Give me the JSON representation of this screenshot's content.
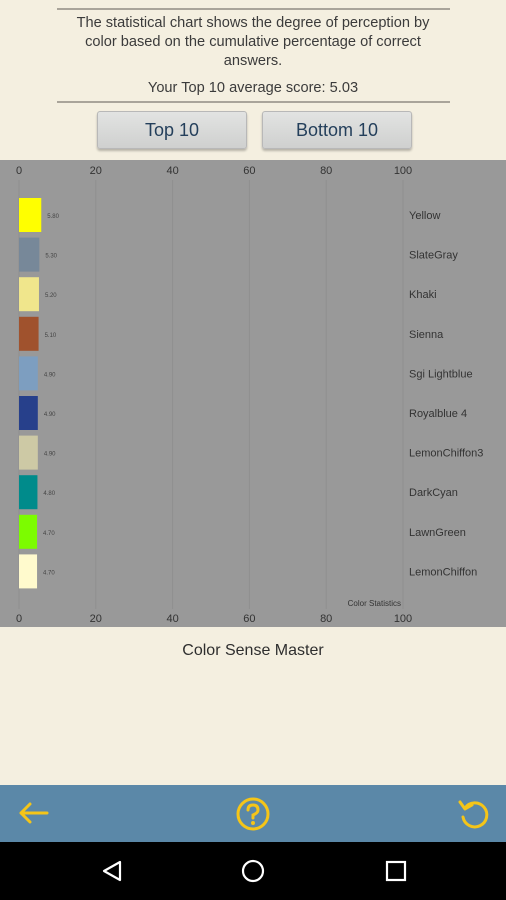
{
  "header": {
    "description": "The statistical chart shows the degree of perception by color based on the cumulative percentage of correct answers.",
    "average_score_text": "Your Top 10 average score: 5.03"
  },
  "buttons": {
    "top": "Top 10",
    "bottom": "Bottom 10"
  },
  "chart_data": {
    "type": "bar",
    "title": "Color Statistics",
    "xlim": [
      0,
      100
    ],
    "x_ticks": [
      0,
      20,
      40,
      60,
      80,
      100
    ],
    "grid": true,
    "orientation": "horizontal",
    "categories": [
      "Yellow",
      "SlateGray",
      "Khaki",
      "Sienna",
      "Sgi Lightblue",
      "Royalblue 4",
      "LemonChiffon3",
      "DarkCyan",
      "LawnGreen",
      "LemonChiffon"
    ],
    "values": [
      5.8,
      5.3,
      5.2,
      5.1,
      4.9,
      4.9,
      4.9,
      4.8,
      4.7,
      4.7
    ],
    "value_labels": [
      "5.80",
      "5.30",
      "5.20",
      "5.10",
      "4.90",
      "4.90",
      "4.90",
      "4.80",
      "4.70",
      "4.70"
    ],
    "colors": [
      "#ffff00",
      "#778899",
      "#f0e68c",
      "#a0522d",
      "#7d9ec0",
      "#27408b",
      "#cdc9a5",
      "#008b8b",
      "#7cfc00",
      "#fffacd"
    ]
  },
  "app_title": "Color Sense Master",
  "bottom_bar": {
    "back_icon": "arrow-left-icon",
    "help_icon": "help-circle-icon",
    "reset_icon": "rotate-icon",
    "icon_color": "#f5c518"
  },
  "navbar": {
    "back": "triangle-back-icon",
    "home": "circle-home-icon",
    "recents": "square-recents-icon"
  }
}
